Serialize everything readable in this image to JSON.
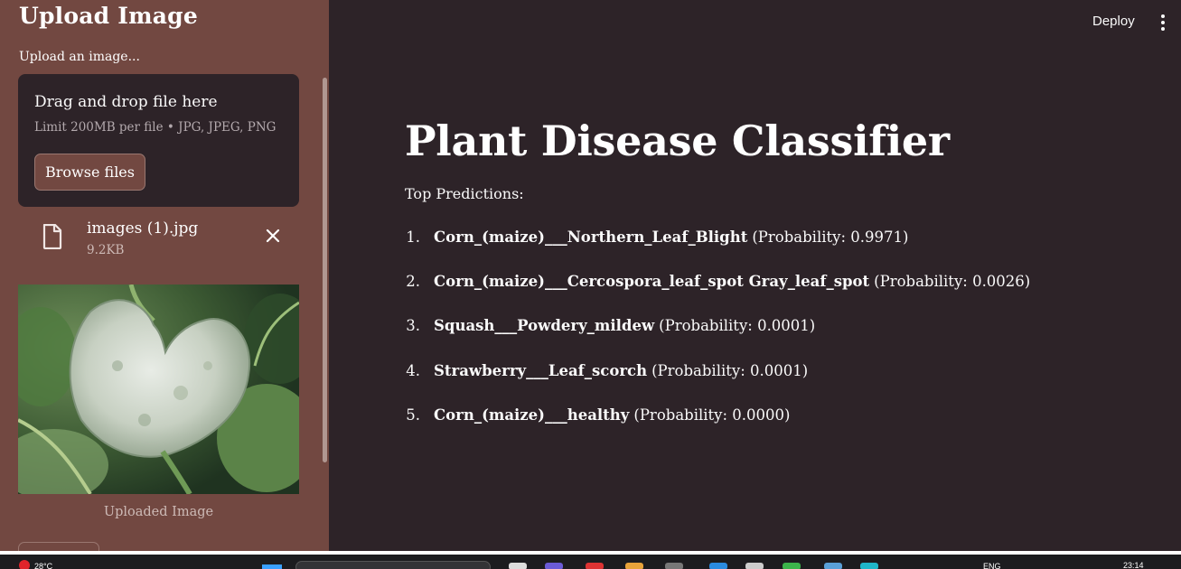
{
  "sidebar": {
    "title": "Upload Image",
    "uploader_label": "Upload an image...",
    "dropzone": {
      "title": "Drag and drop file here",
      "limit": "Limit 200MB per file • JPG, JPEG, PNG",
      "browse_label": "Browse files"
    },
    "file": {
      "name": "images (1).jpg",
      "size": "9.2KB",
      "icon": "file-icon",
      "remove_icon": "close-icon"
    },
    "image_caption": "Uploaded Image"
  },
  "header": {
    "deploy_label": "Deploy",
    "menu_icon": "vertical-dots-icon"
  },
  "main": {
    "title": "Plant Disease Classifier",
    "subtitle": "Top Predictions:",
    "predictions": [
      {
        "num": "1.",
        "label": "Corn_(maize)___Northern_Leaf_Blight",
        "prob": "(Probability: 0.9971)"
      },
      {
        "num": "2.",
        "label": "Corn_(maize)___Cercospora_leaf_spot Gray_leaf_spot",
        "prob": "(Probability: 0.0026)"
      },
      {
        "num": "3.",
        "label": "Squash___Powdery_mildew",
        "prob": "(Probability: 0.0001)"
      },
      {
        "num": "4.",
        "label": "Strawberry___Leaf_scorch",
        "prob": "(Probability: 0.0001)"
      },
      {
        "num": "5.",
        "label": "Corn_(maize)___healthy",
        "prob": "(Probability: 0.0000)"
      }
    ]
  },
  "taskbar": {
    "weather": "28°C",
    "badge": "1",
    "lang": "ENG",
    "time": "23:14"
  },
  "colors": {
    "sidebar_bg": "#724841",
    "main_bg": "#2d2328",
    "text": "#fafafa"
  }
}
